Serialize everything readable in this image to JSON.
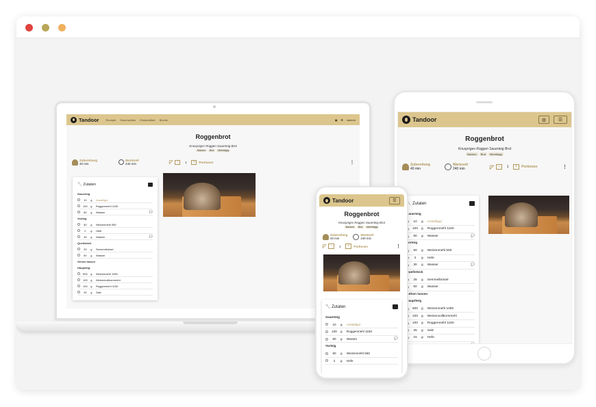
{
  "colors": {
    "nav": "#dcc68e",
    "accent": "#b0965a",
    "dot_red": "#e0443e",
    "dot_olive": "#b9a657",
    "dot_orange": "#f0b060"
  },
  "app": {
    "name": "Tandoor"
  },
  "nav": {
    "links": [
      "Rezepte",
      "Essenspläne",
      "Einkaufsliste",
      "Bücher"
    ],
    "user": "vabene"
  },
  "recipe": {
    "title": "Roggenbrot",
    "subtitle": "Knuspriges Roggen Sauerteig Brot",
    "keywords": [
      "Backen",
      "Brot",
      "Mehrtägig"
    ],
    "prep_label": "Zubereitung",
    "prep_value": "40 min",
    "wait_label": "Wartezeit",
    "wait_value": "240 min",
    "servings": "1",
    "servings_label": "Portionen",
    "minus": "−",
    "plus": "+",
    "more": "⋮",
    "ingredients_title": "Zutaten"
  },
  "ingredients": [
    {
      "section": "Sauerteig"
    },
    {
      "amount": "10",
      "unit": "g",
      "food": "Anstellgut",
      "link": true
    },
    {
      "amount": "100",
      "unit": "g",
      "food": "Roggenmehl 1150"
    },
    {
      "amount": "80",
      "unit": "g",
      "food": "Wasser",
      "note": true
    },
    {
      "section": "Vorteig"
    },
    {
      "amount": "50",
      "unit": "g",
      "food": "Weizenmehl 550"
    },
    {
      "amount": "2",
      "unit": "g",
      "food": "Hefe"
    },
    {
      "amount": "30",
      "unit": "g",
      "food": "Wasser",
      "note": true
    },
    {
      "section": "Quellstück"
    },
    {
      "amount": "25",
      "unit": "g",
      "food": "Semmelbrösel"
    },
    {
      "amount": "50",
      "unit": "g",
      "food": "Wasser"
    },
    {
      "section": "Gehen lassen"
    },
    {
      "section": "Hauptteig"
    },
    {
      "amount": "500",
      "unit": "g",
      "food": "Weizenmehl 1050"
    },
    {
      "amount": "100",
      "unit": "g",
      "food": "Weizenvollkornmehl"
    },
    {
      "amount": "100",
      "unit": "g",
      "food": "Roggenmehl 1150"
    },
    {
      "amount": "25",
      "unit": "g",
      "food": "Salz"
    },
    {
      "amount": "15",
      "unit": "g",
      "food": "Hefe"
    },
    {
      "amount": "430",
      "unit": "g",
      "food": "Wasser",
      "note": true
    }
  ]
}
